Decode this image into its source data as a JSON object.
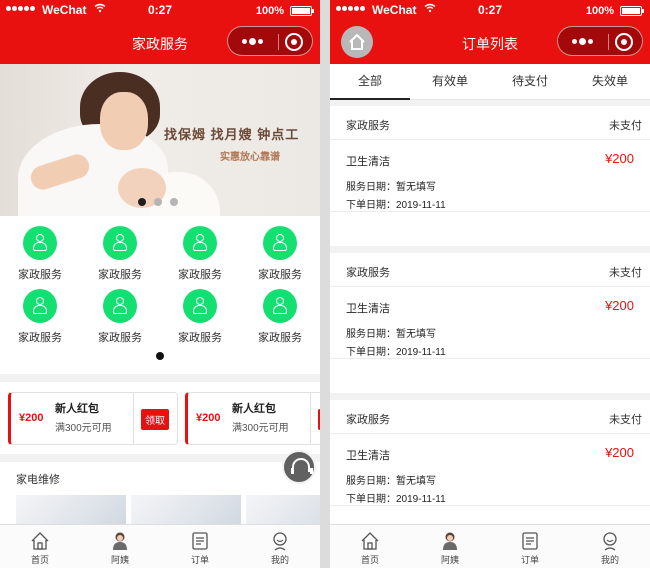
{
  "status_bar": {
    "carrier": "WeChat",
    "time": "0:27",
    "battery": "100%"
  },
  "home_page": {
    "nav_title": "家政服务",
    "banner": {
      "slogan": "找保姆 找月嫂 钟点工",
      "subslogan": "实惠放心靠谱",
      "slide_count": 3,
      "active_slide": 1
    },
    "categories": [
      {
        "label": "家政服务",
        "icon": "person-icon"
      },
      {
        "label": "家政服务",
        "icon": "person-icon"
      },
      {
        "label": "家政服务",
        "icon": "person-icon"
      },
      {
        "label": "家政服务",
        "icon": "person-icon"
      },
      {
        "label": "家政服务",
        "icon": "person-icon"
      },
      {
        "label": "家政服务",
        "icon": "person-icon"
      },
      {
        "label": "家政服务",
        "icon": "person-icon"
      },
      {
        "label": "家政服务",
        "icon": "person-icon"
      }
    ],
    "coupons": [
      {
        "amount": "¥200",
        "name": "新人红包",
        "condition": "满300元可用",
        "claim_label": "领取"
      },
      {
        "amount": "¥200",
        "name": "新人红包",
        "condition": "满300元可用",
        "claim_label": "领取"
      }
    ],
    "section_title": "家电维修",
    "accent_color": "#e8110f",
    "category_color": "#13e070"
  },
  "tabbar": [
    {
      "label": "首页",
      "icon": "home-icon"
    },
    {
      "label": "阿姨",
      "icon": "nanny-icon"
    },
    {
      "label": "订单",
      "icon": "order-icon"
    },
    {
      "label": "我的",
      "icon": "profile-icon"
    }
  ],
  "orders_page": {
    "nav_title": "订单列表",
    "tabs": [
      "全部",
      "有效单",
      "待支付",
      "失效单"
    ],
    "active_tab": 0,
    "orders": [
      {
        "shop": "家政服务",
        "status": "未支付",
        "service": "卫生清洁",
        "price": "¥200",
        "service_date": "服务日期：暂无填写",
        "order_date": "下单日期：2019-11-11"
      },
      {
        "shop": "家政服务",
        "status": "未支付",
        "service": "卫生清洁",
        "price": "¥200",
        "service_date": "服务日期：暂无填写",
        "order_date": "下单日期：2019-11-11"
      },
      {
        "shop": "家政服务",
        "status": "未支付",
        "service": "卫生清洁",
        "price": "¥200",
        "service_date": "服务日期：暂无填写",
        "order_date": "下单日期：2019-11-11"
      }
    ]
  }
}
